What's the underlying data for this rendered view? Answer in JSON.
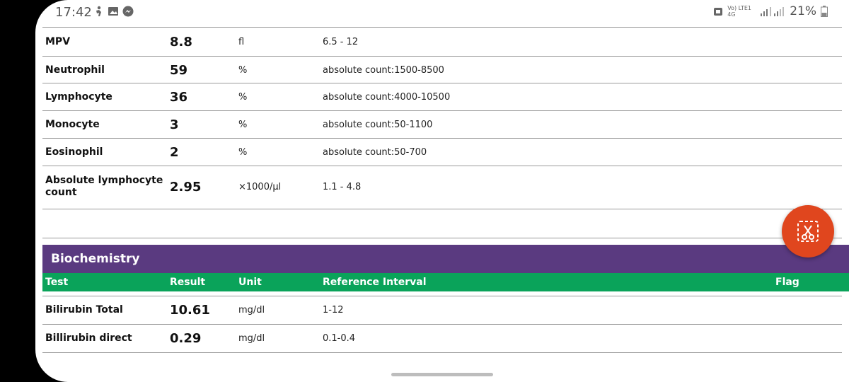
{
  "status_bar": {
    "time": "17:42",
    "left_icons": [
      "person-icon",
      "gallery-icon",
      "messenger-icon"
    ],
    "network": "Vo) LTE1 4G",
    "battery": "21%"
  },
  "top_rows": [
    {
      "test": "MPV",
      "result": "8.8",
      "unit": "fl",
      "reference": "6.5 - 12"
    },
    {
      "test": "Neutrophil",
      "result": "59",
      "unit": "%",
      "reference": "absolute count:1500-8500"
    },
    {
      "test": "Lymphocyte",
      "result": "36",
      "unit": "%",
      "reference": "absolute count:4000-10500"
    },
    {
      "test": "Monocyte",
      "result": "3",
      "unit": "%",
      "reference": "absolute count:50-1100"
    },
    {
      "test": "Eosinophil",
      "result": "2",
      "unit": "%",
      "reference": "absolute count:50-700"
    },
    {
      "test": "Absolute lymphocyte count",
      "result": "2.95",
      "unit": "×1000/µl",
      "reference": "1.1 - 4.8"
    }
  ],
  "biochemistry": {
    "title": "Biochemistry",
    "headers": {
      "test": "Test",
      "result": "Result",
      "unit": "Unit",
      "reference": "Reference Interval",
      "flag": "Flag"
    },
    "rows": [
      {
        "test": "Bilirubin Total",
        "result": "10.61",
        "unit": "mg/dl",
        "reference": "1-12"
      },
      {
        "test": "Billirubin direct",
        "result": "0.29",
        "unit": "mg/dl",
        "reference": "0.1-0.4"
      }
    ]
  },
  "fab": {
    "icon": "screenshot-scissors-icon"
  },
  "colors": {
    "section": "#5a3a80",
    "header": "#0aa35a",
    "fab": "#e0461e"
  }
}
